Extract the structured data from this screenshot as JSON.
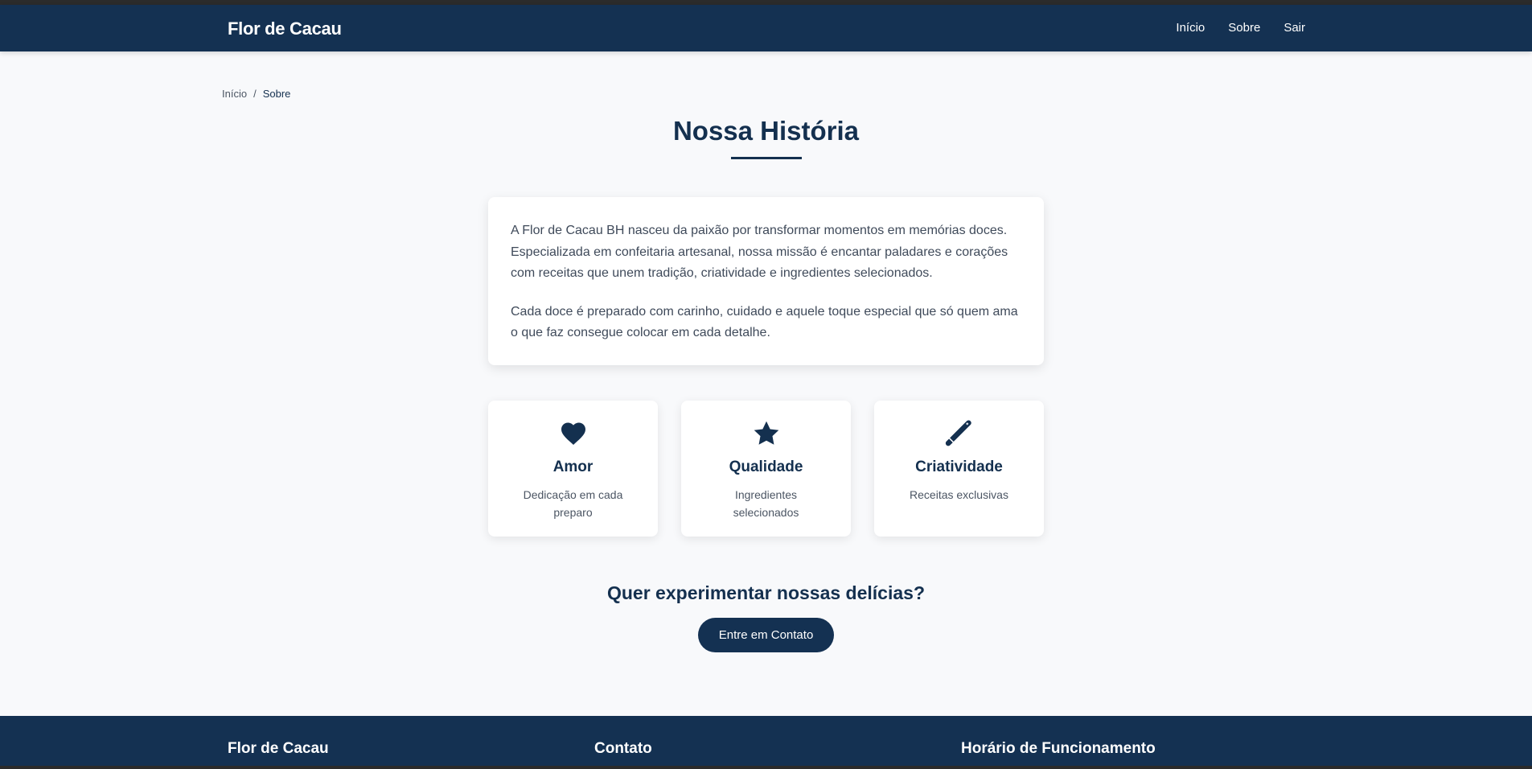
{
  "navbar": {
    "brand": "Flor de Cacau",
    "links": [
      "Início",
      "Sobre",
      "Sair"
    ]
  },
  "breadcrumb": {
    "home": "Início",
    "separator": "/",
    "current": "Sobre"
  },
  "page": {
    "title": "Nossa História"
  },
  "story": {
    "paragraphs": [
      "A Flor de Cacau BH nasceu da paixão por transformar momentos em memórias doces. Especializada em confeitaria artesanal, nossa missão é encantar paladares e corações com receitas que unem tradição, criatividade e ingredientes selecionados.",
      "Cada doce é preparado com carinho, cuidado e aquele toque especial que só quem ama o que faz consegue colocar em cada detalhe."
    ]
  },
  "values": [
    {
      "icon": "heart-icon",
      "title": "Amor",
      "description": "Dedicação em cada preparo"
    },
    {
      "icon": "star-icon",
      "title": "Qualidade",
      "description": "Ingredientes selecionados"
    },
    {
      "icon": "magic-wand-icon",
      "title": "Criatividade",
      "description": "Receitas exclusivas"
    }
  ],
  "cta": {
    "heading": "Quer experimentar nossas delícias?",
    "button_label": "Entre em Contato"
  },
  "footer": {
    "columns": [
      "Flor de Cacau",
      "Contato",
      "Horário de Funcionamento"
    ]
  },
  "colors": {
    "primary": "#143152",
    "background": "#f8f9fb",
    "card": "#ffffff",
    "text_muted": "#4b5563"
  }
}
